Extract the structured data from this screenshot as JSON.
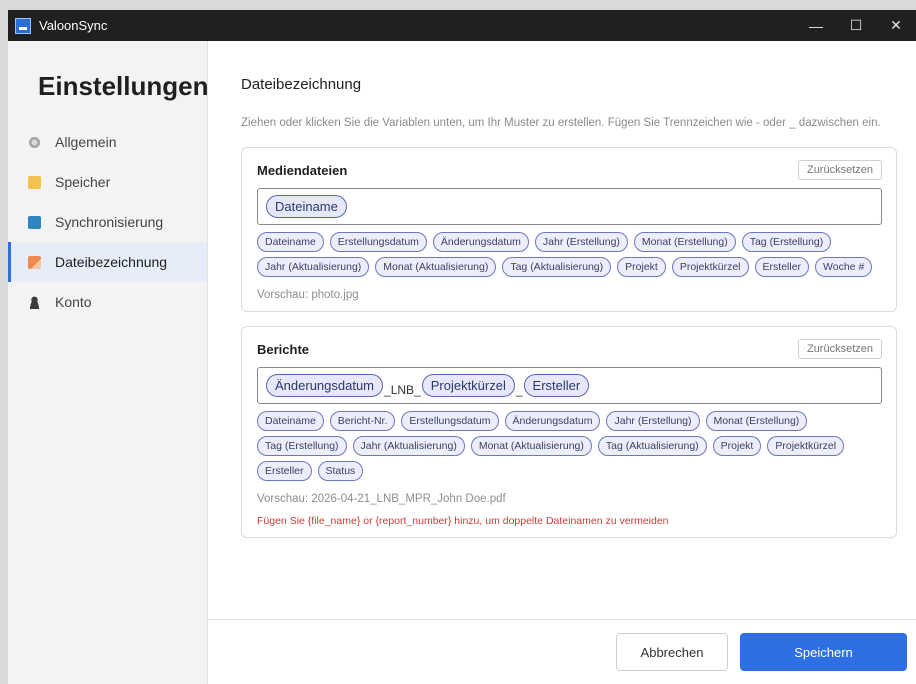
{
  "window": {
    "title": "ValoonSync",
    "controls": {
      "minimize": "—",
      "maximize": "☐",
      "close": "✕"
    }
  },
  "sidebar": {
    "heading": "Einstellungen",
    "items": [
      {
        "label": "Allgemein",
        "icon": "gear-icon",
        "active": false
      },
      {
        "label": "Speicher",
        "icon": "folder-icon",
        "active": false
      },
      {
        "label": "Synchronisierung",
        "icon": "sync-icon",
        "active": false
      },
      {
        "label": "Dateibezeichnung",
        "icon": "document-icon",
        "active": true
      },
      {
        "label": "Konto",
        "icon": "user-icon",
        "active": false
      }
    ]
  },
  "main": {
    "title": "Dateibezeichnung",
    "hint": "Ziehen oder klicken Sie die Variablen unten, um Ihr Muster zu erstellen. Fügen Sie Trennzeichen wie - oder _ dazwischen ein.",
    "media": {
      "title": "Mediendateien",
      "reset_label": "Zurücksetzen",
      "pattern": [
        "Dateiname"
      ],
      "variables": [
        "Dateiname",
        "Erstellungsdatum",
        "Änderungsdatum",
        "Jahr (Erstellung)",
        "Monat (Erstellung)",
        "Tag (Erstellung)",
        "Jahr (Aktualisierung)",
        "Monat (Aktualisierung)",
        "Tag (Aktualisierung)",
        "Projekt",
        "Projektkürzel",
        "Ersteller",
        "Woche #"
      ],
      "preview": "Vorschau: photo.jpg"
    },
    "reports": {
      "title": "Berichte",
      "reset_label": "Zurücksetzen",
      "pattern": {
        "chip1": "Änderungsdatum",
        "sep1": "_LNB_",
        "chip2": "Projektkürzel",
        "sep2": "_",
        "chip3": "Ersteller"
      },
      "variables": [
        "Dateiname",
        "Bericht-Nr.",
        "Erstellungsdatum",
        "Änderungsdatum",
        "Jahr (Erstellung)",
        "Monat (Erstellung)",
        "Tag (Erstellung)",
        "Jahr (Aktualisierung)",
        "Monat (Aktualisierung)",
        "Tag (Aktualisierung)",
        "Projekt",
        "Projektkürzel",
        "Ersteller",
        "Status"
      ],
      "preview": "Vorschau: 2026-04-21_LNB_MPR_John Doe.pdf",
      "warning": "Fügen Sie {file_name} or {report_number} hinzu, um doppelte Dateinamen zu vermeiden"
    }
  },
  "footer": {
    "cancel_label": "Abbrechen",
    "save_label": "Speichern"
  },
  "colors": {
    "accent": "#2f6fe4",
    "chip_border": "#6e77bd",
    "warning": "#d13b3b"
  }
}
